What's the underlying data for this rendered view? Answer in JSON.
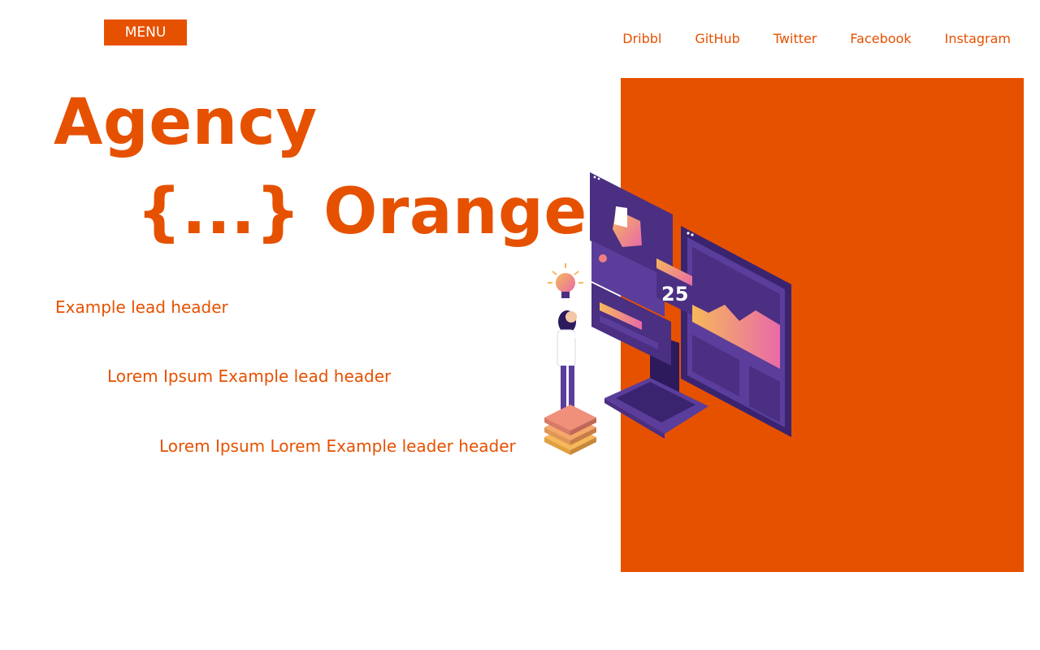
{
  "header": {
    "menu_label": "MENU",
    "social_links": [
      "Dribbl",
      "GitHub",
      "Twitter",
      "Facebook",
      "Instagram"
    ]
  },
  "hero": {
    "title_line1": "Agency",
    "title_line2": "{...} Orange",
    "leads": [
      "Example lead header",
      "Lorem Ipsum Example lead header",
      "Lorem Ipsum Lorem Example leader header"
    ]
  },
  "illustration": {
    "counter_value": "25"
  },
  "colors": {
    "accent": "#e65100",
    "illustration_purple": "#4a2f82",
    "illustration_purple_light": "#6a4aa6",
    "illustration_pink": "#e86aa8",
    "illustration_yellow": "#f7b85a"
  }
}
